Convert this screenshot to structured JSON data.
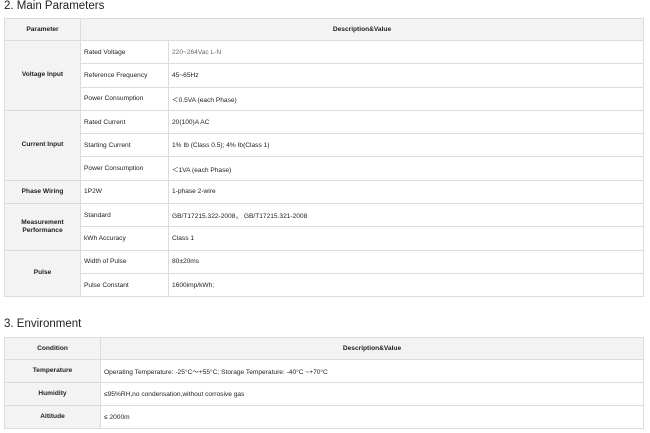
{
  "sections": [
    {
      "title": "2. Main Parameters",
      "headers": [
        "Parameter",
        "Description&Value"
      ],
      "groups": [
        {
          "name": "Voltage Input",
          "rows": [
            {
              "param": "Rated Voltage",
              "value": "220~264Vac L-N"
            },
            {
              "param": "Reference Frequency",
              "value": "45~65Hz"
            },
            {
              "param": "Power Consumption",
              "value": "＜0.5VA (each Phase)"
            }
          ]
        },
        {
          "name": "Current Input",
          "rows": [
            {
              "param": "Rated Current",
              "value": "20(100)A AC"
            },
            {
              "param": "Starting Current",
              "value": "1% Ib (Class 0.5); 4% Ib(Class 1)"
            },
            {
              "param": "Power Consumption",
              "value": "＜1VA (each Phase)"
            }
          ]
        },
        {
          "name": "Phase Wiring",
          "rows": [
            {
              "param": "1P2W",
              "value": "1-phase 2-wire"
            }
          ]
        },
        {
          "name": "Measurement Performance",
          "rows": [
            {
              "param": "Standard",
              "value": "GB/T17215.322-2008， GB/T17215.321-2008"
            },
            {
              "param": "kWh Accuracy",
              "value": "Class 1"
            }
          ]
        },
        {
          "name": "Pulse",
          "rows": [
            {
              "param": "Width of Pulse",
              "value": "80±20ms"
            },
            {
              "param": "Pulse Constant",
              "value": "1600imp/kWh;"
            }
          ]
        }
      ]
    },
    {
      "title": "3. Environment",
      "headers": [
        "Condition",
        "Description&Value"
      ],
      "rows": [
        {
          "name": "Temperature",
          "value": "Operating Temperature: -25°C～+55°C;  Storage Temperature: -40°C ~+70°C"
        },
        {
          "name": "Humidity",
          "value": "≤95%RH,no condensation,without corrosive gas"
        },
        {
          "name": "Altitude",
          "value": "≤ 2000m"
        }
      ]
    }
  ]
}
